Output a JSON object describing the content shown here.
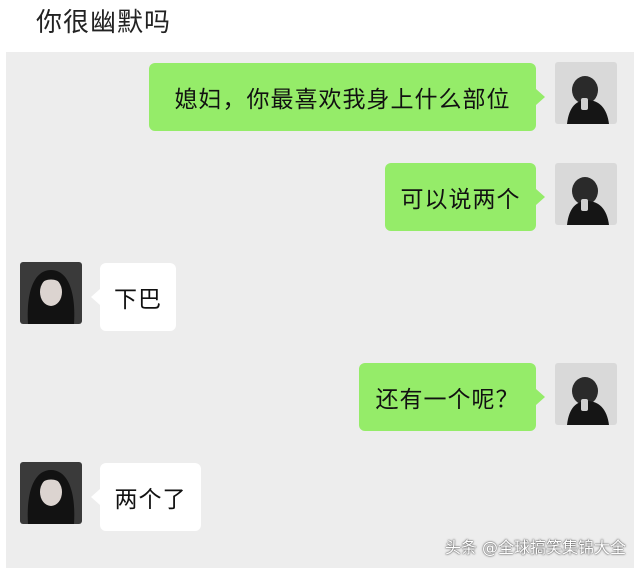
{
  "header": {
    "title": "你很幽默吗"
  },
  "messages": [
    {
      "side": "sent",
      "text": "媳妇，你最喜欢我身上什么部位"
    },
    {
      "side": "sent",
      "text": "可以说两个"
    },
    {
      "side": "received",
      "text": "下巴"
    },
    {
      "side": "sent",
      "text": "还有一个呢？"
    },
    {
      "side": "received",
      "text": "两个了"
    }
  ],
  "watermark": "头条 @全球搞笑集锦大全",
  "colors": {
    "sent_bubble": "#95ec69",
    "received_bubble": "#ffffff",
    "chat_background": "#ededed"
  }
}
